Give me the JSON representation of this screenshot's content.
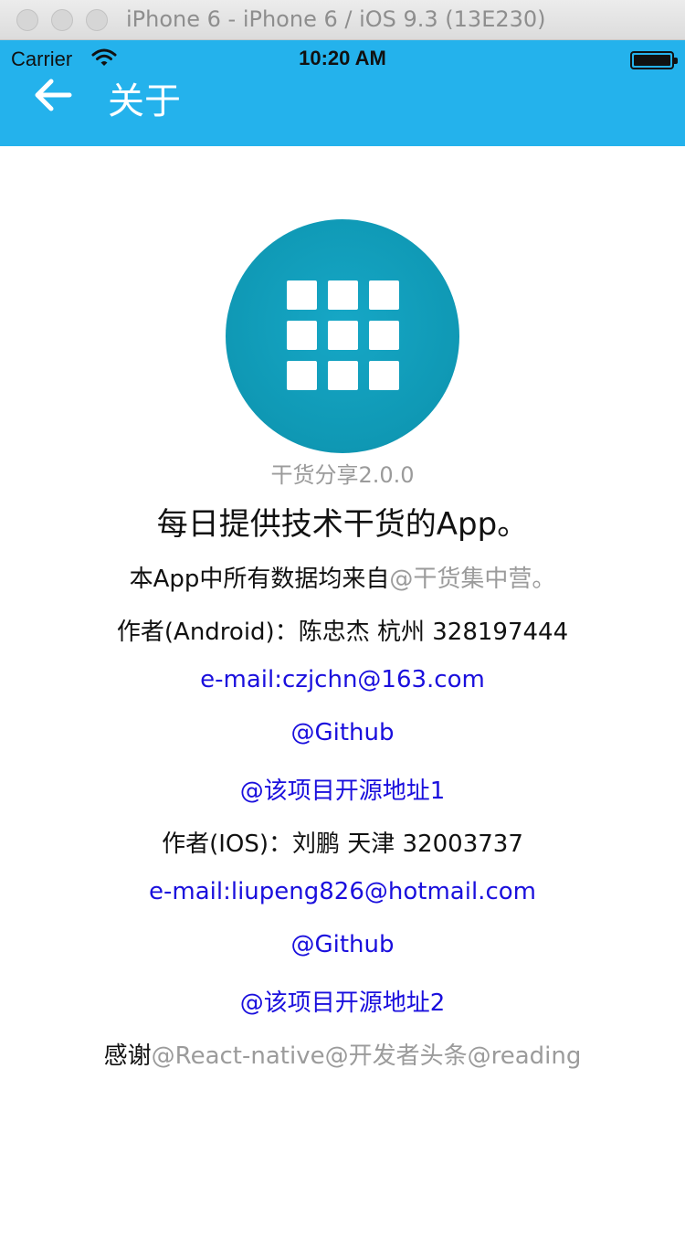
{
  "window": {
    "title": "iPhone 6 - iPhone 6 / iOS 9.3 (13E230)"
  },
  "status_bar": {
    "carrier": "Carrier",
    "time": "10:20 AM"
  },
  "nav": {
    "title": "关于",
    "back_icon": "arrow-left-icon"
  },
  "colors": {
    "header": "#24b2ec",
    "link": "#1a0fdd",
    "muted": "#9b9b9b",
    "logo": "#0f98b4"
  },
  "about": {
    "logo_icon": "grid-apps-icon",
    "version": "干货分享2.0.0",
    "headline": "每日提供技术干货的App。",
    "source_prefix": "本App中所有数据均来自",
    "source_link": "@干货集中营。",
    "android_author": "作者(Android)：陈忠杰 杭州 328197444",
    "android_email": "e-mail:czjchn@163.com",
    "android_github": "@Github",
    "android_repo": "@该项目开源地址1",
    "ios_author": "作者(IOS)：刘鹏 天津 32003737",
    "ios_email": "e-mail:liupeng826@hotmail.com",
    "ios_github": "@Github",
    "ios_repo": "@该项目开源地址2",
    "thanks_prefix": "感谢",
    "thanks_links": "@React-native@开发者头条@reading"
  }
}
